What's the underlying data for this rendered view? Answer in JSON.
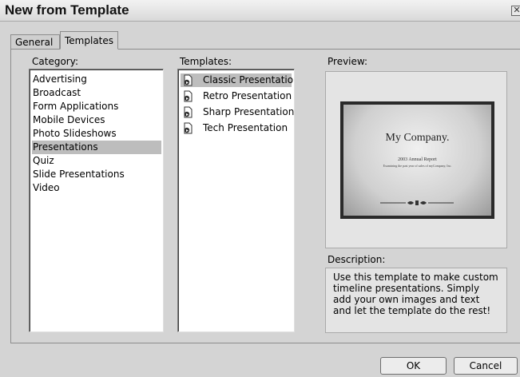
{
  "window": {
    "title": "New from Template",
    "close_glyph": "✕"
  },
  "tabs": [
    {
      "label": "General",
      "active": false
    },
    {
      "label": "Templates",
      "active": true
    }
  ],
  "category": {
    "label": "Category:",
    "items": [
      "Advertising",
      "Broadcast",
      "Form Applications",
      "Mobile Devices",
      "Photo Slideshows",
      "Presentations",
      "Quiz",
      "Slide Presentations",
      "Video"
    ],
    "selected": "Presentations"
  },
  "templates": {
    "label": "Templates:",
    "items": [
      "Classic Presentation",
      "Retro Presentation",
      "Sharp Presentation",
      "Tech Presentation"
    ],
    "selected": "Classic Presentation",
    "icon": "document-icon"
  },
  "preview": {
    "label": "Preview:",
    "slide_title": "My Company.",
    "slide_report": "2003 Annual Report",
    "slide_subtitle": "Examining the past year of sales of myCompany, Inc."
  },
  "description": {
    "label": "Description:",
    "text": "Use this template to make custom timeline presentations. Simply add your own images and text and let the template do the rest!"
  },
  "buttons": {
    "ok": "OK",
    "cancel": "Cancel"
  },
  "colors": {
    "selection": "#bdbdbd",
    "dialog_bg": "#d4d4d4"
  }
}
